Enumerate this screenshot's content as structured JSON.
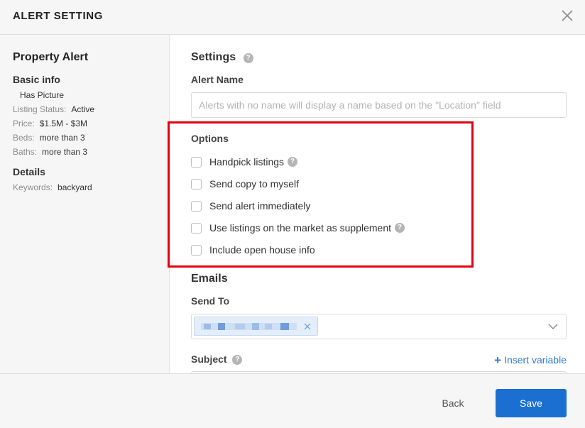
{
  "header": {
    "title": "ALERT SETTING",
    "close_icon": "close-icon"
  },
  "sidebar": {
    "title": "Property Alert",
    "basic_info": {
      "heading": "Basic info",
      "rows": [
        {
          "label": "",
          "value": "Has Picture"
        },
        {
          "label": "Listing Status:",
          "value": "Active"
        },
        {
          "label": "Price:",
          "value": "$1.5M - $3M"
        },
        {
          "label": "Beds:",
          "value": "more than 3"
        },
        {
          "label": "Baths:",
          "value": "more than 3"
        }
      ]
    },
    "details": {
      "heading": "Details",
      "rows": [
        {
          "label": "Keywords:",
          "value": "backyard"
        }
      ]
    }
  },
  "main": {
    "settings": {
      "title": "Settings",
      "help_icon": "question-circle-icon"
    },
    "alert_name": {
      "label": "Alert Name",
      "value": "",
      "placeholder": "Alerts with no name will display a name based on the \"Location\" field"
    },
    "options": {
      "title": "Options",
      "items": [
        {
          "label": "Handpick listings",
          "checked": false,
          "help": true
        },
        {
          "label": "Send copy to myself",
          "checked": false,
          "help": false
        },
        {
          "label": "Send alert immediately",
          "checked": false,
          "help": false
        },
        {
          "label": "Use listings on the market as supplement",
          "checked": false,
          "help": true
        },
        {
          "label": "Include open house info",
          "checked": false,
          "help": false
        }
      ]
    },
    "emails": {
      "title": "Emails",
      "send_to_label": "Send To",
      "recipient_tag": "redacted-email",
      "dropdown_icon": "chevron-down-icon"
    },
    "subject": {
      "label": "Subject",
      "insert_plus": "+",
      "insert_variable": "Insert variable"
    }
  },
  "footer": {
    "back_label": "Back",
    "save_label": "Save"
  },
  "colors": {
    "accent": "#1a6fd1",
    "link": "#2f7bd9",
    "highlight_border": "#e3000f",
    "panel_bg": "#f6f6f6"
  }
}
